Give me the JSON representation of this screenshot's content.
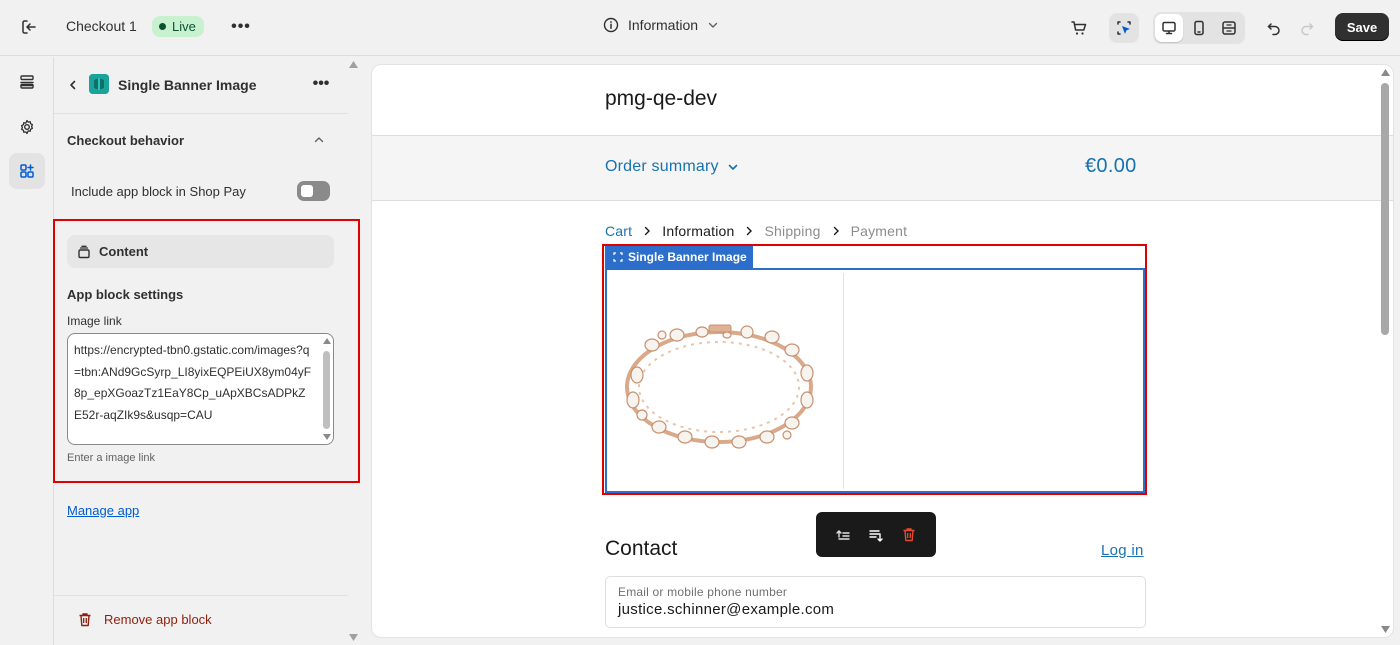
{
  "topbar": {
    "exit_icon": "exit-icon",
    "title": "Checkout 1",
    "status": "Live",
    "more": "•••",
    "page_selector": "Information",
    "save_label": "Save"
  },
  "rail": {
    "items": [
      "sections-icon",
      "settings-icon",
      "apps-icon"
    ]
  },
  "panel": {
    "title": "Single Banner Image",
    "more": "•••",
    "section_title": "Checkout behavior",
    "shop_pay_label": "Include app block in Shop Pay",
    "content_label": "Content",
    "settings_title": "App block settings",
    "image_link_label": "Image link",
    "image_link_value": "https://encrypted-tbn0.gstatic.com/images?q=tbn:ANd9GcSyrp_LI8yixEQPEiUX8ym04yF8p_epXGoazTz1EaY8Cp_uApXBCsADPkZE52r-aqZIk9s&usqp=CAU",
    "image_link_help": "Enter a image link",
    "manage_link": "Manage app",
    "remove_label": "Remove app block"
  },
  "preview": {
    "shop_name": "pmg-qe-dev",
    "order_summary": "Order summary",
    "total": "€0.00",
    "breadcrumbs": {
      "cart": "Cart",
      "information": "Information",
      "shipping": "Shipping",
      "payment": "Payment"
    },
    "block_tag": "Single Banner Image",
    "contact_title": "Contact",
    "login_link": "Log in",
    "email_placeholder": "Email or mobile phone number",
    "email_value": "justice.schinner@example.com"
  },
  "colors": {
    "accent_link": "#1773b0",
    "live_badge_bg": "#c8f2cf",
    "highlight": "#e00000",
    "block_blue": "#2c6ecb",
    "remove_red": "#8e1f0b"
  }
}
